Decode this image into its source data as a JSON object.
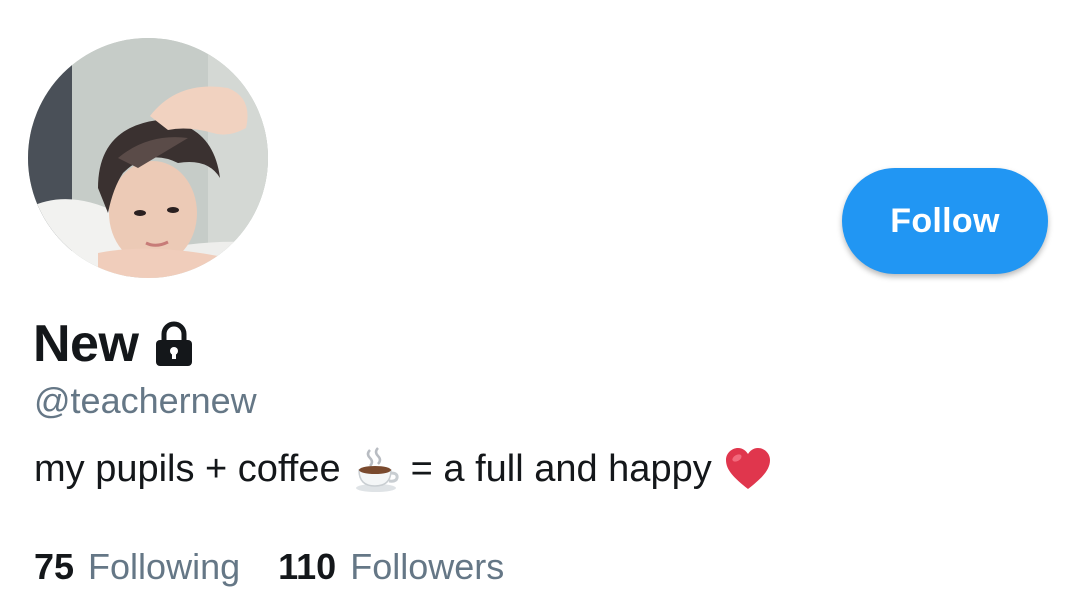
{
  "profile": {
    "display_name": "New",
    "handle": "@teachernew",
    "bio": {
      "part1": "my pupils + coffee",
      "emoji1": "coffee-cup-icon",
      "part2": "= a full and happy",
      "emoji2": "red-heart-icon"
    },
    "locked": true,
    "lock_icon": "lock-icon"
  },
  "actions": {
    "follow_label": "Follow"
  },
  "stats": {
    "following_count": "75",
    "following_label": "Following",
    "followers_count": "110",
    "followers_label": "Followers"
  },
  "colors": {
    "accent": "#2196f3",
    "text_primary": "#14171a",
    "text_secondary": "#657786",
    "heart": "#e0364d"
  }
}
